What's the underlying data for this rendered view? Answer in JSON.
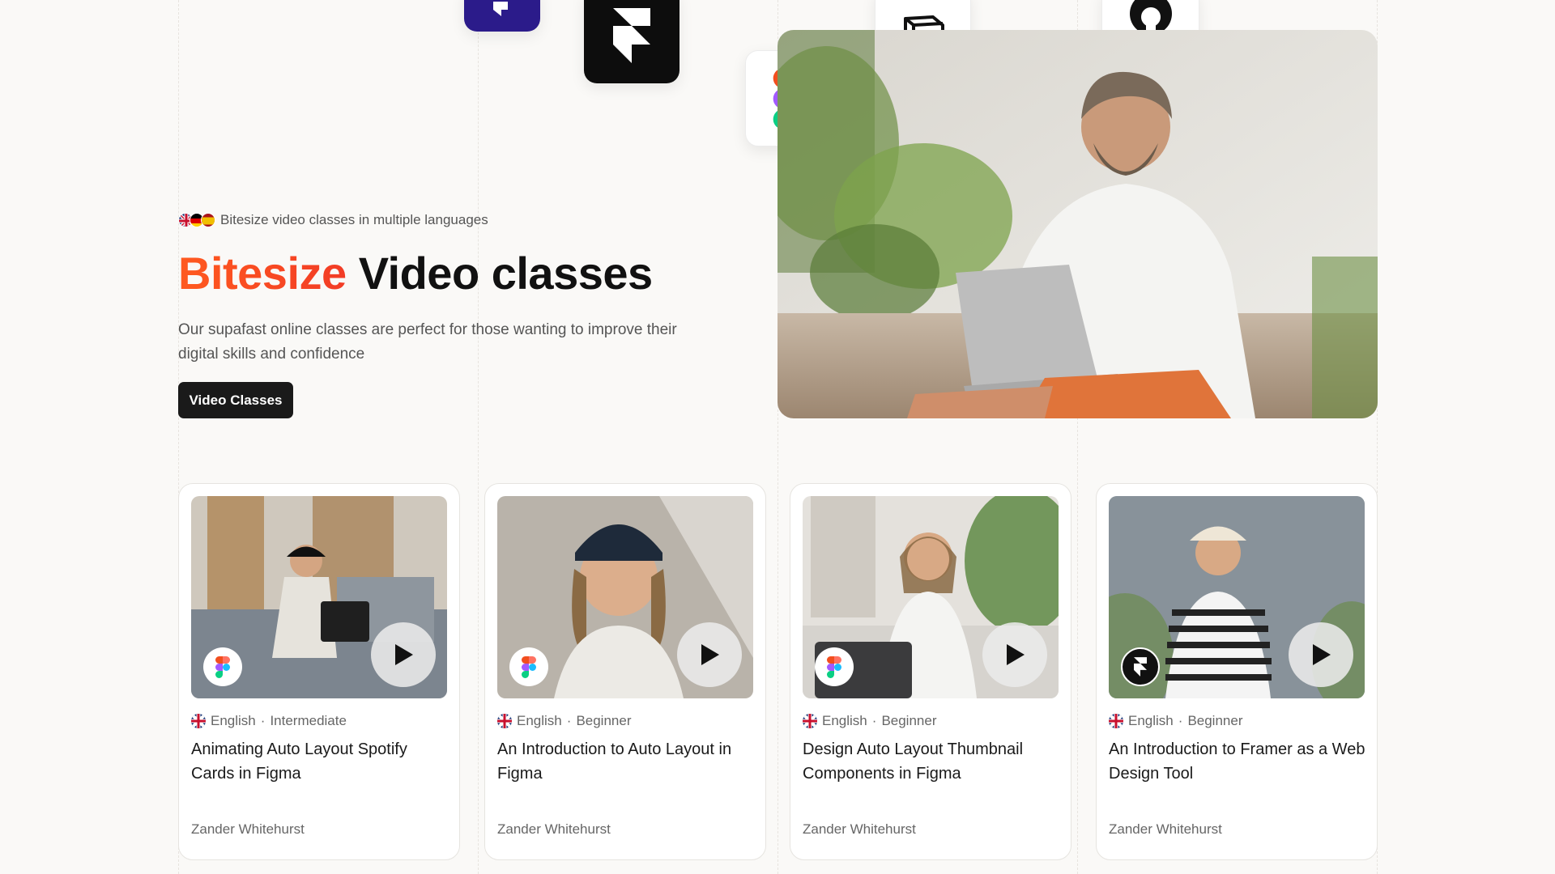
{
  "hero": {
    "tagline": "Bitesize video classes in multiple languages",
    "headline_accent": "Bitesize",
    "headline_rest": "Video classes",
    "subtitle": "Our supafast online classes are perfect for those wanting to improve their digital skills and confidence",
    "cta_label": "Video Classes",
    "languages": [
      "uk-flag-icon",
      "germany-flag-icon",
      "spain-flag-icon"
    ],
    "accent_color": "#f4451f"
  },
  "floating_icons": [
    "purple-app-icon",
    "framer-icon",
    "figma-icon",
    "notion-icon",
    "github-icon"
  ],
  "classes": [
    {
      "language": "English",
      "level": "Intermediate",
      "title": "Animating Auto Layout Spotify Cards in Figma",
      "author": "Zander Whitehurst",
      "tool": "figma-icon"
    },
    {
      "language": "English",
      "level": "Beginner",
      "title": "An Introduction to Auto Layout in Figma",
      "author": "Zander Whitehurst",
      "tool": "figma-icon"
    },
    {
      "language": "English",
      "level": "Beginner",
      "title": "Design Auto Layout Thumbnail Components in Figma",
      "author": "Zander Whitehurst",
      "tool": "figma-icon"
    },
    {
      "language": "English",
      "level": "Beginner",
      "title": "An Introduction to Framer as a Web Design Tool",
      "author": "Zander Whitehurst",
      "tool": "framer-icon"
    }
  ],
  "separator": "·"
}
